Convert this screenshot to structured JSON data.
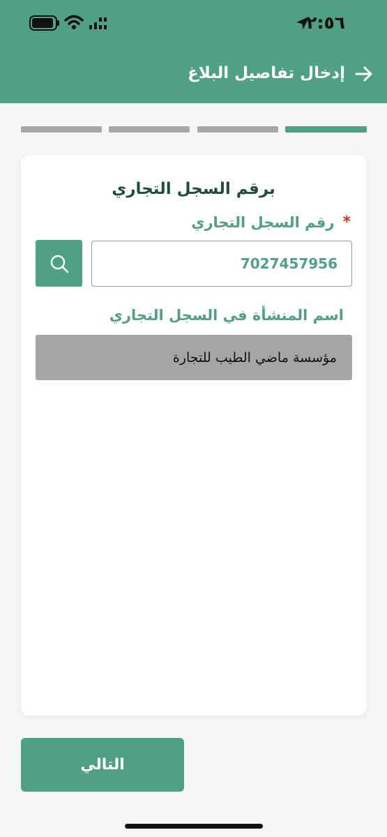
{
  "status_bar": {
    "time": "٢:٥٦",
    "icons": [
      "location-arrow-icon",
      "battery-icon",
      "wifi-icon",
      "cellular-signal-icon"
    ]
  },
  "app_bar": {
    "title": "إدخال تفاصيل البلاغ",
    "back_icon": "arrow-right-icon",
    "background_color": "#50a083"
  },
  "stepper": {
    "total_steps": 4,
    "current_step": 1,
    "active_color": "#50a083",
    "inactive_color": "#a7a7a7"
  },
  "form": {
    "title": "برقم السجل التجاري",
    "cr_label": "رقم السجل التجاري",
    "required_mark": "*",
    "cr_value": "7027457956",
    "search_icon": "search-icon",
    "establishment_label": "اسم المنشأة في السجل التجاري",
    "establishment_value": "مؤسسة ماضي الطيب للتجارة"
  },
  "actions": {
    "next_label": "التالي"
  }
}
